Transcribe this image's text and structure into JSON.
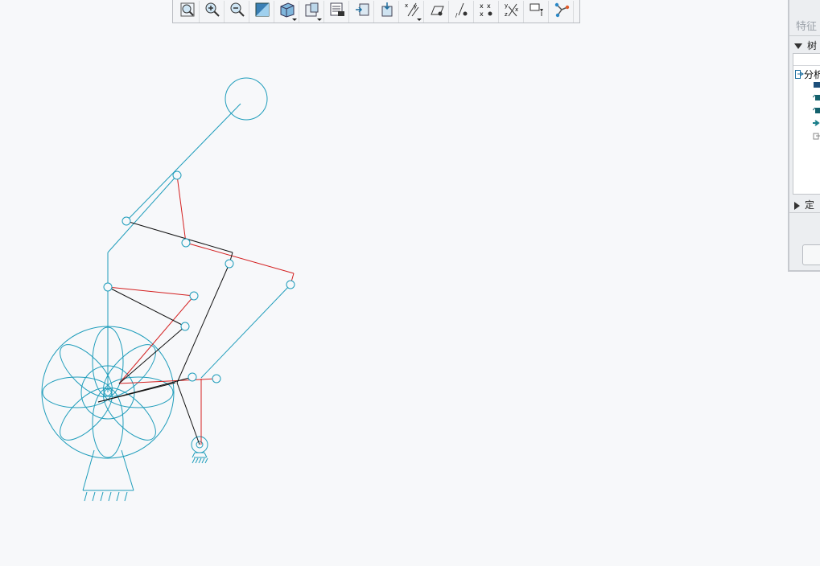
{
  "toolbar": {
    "buttons": [
      {
        "icon": "zoom-fit-icon",
        "has_dropdown": false
      },
      {
        "icon": "zoom-in-icon",
        "has_dropdown": false
      },
      {
        "icon": "zoom-out-icon",
        "has_dropdown": false
      },
      {
        "icon": "repaint-icon",
        "has_dropdown": false
      },
      {
        "icon": "display-style-icon",
        "has_dropdown": true
      },
      {
        "icon": "saved-orientations-icon",
        "has_dropdown": true
      },
      {
        "icon": "view-manager-icon",
        "has_dropdown": false
      },
      {
        "icon": "section-view-icon",
        "has_dropdown": false
      },
      {
        "icon": "perspective-icon",
        "has_dropdown": false
      },
      {
        "icon": "datum-display-icon",
        "has_dropdown": true
      },
      {
        "icon": "plane-display-icon",
        "has_dropdown": false
      },
      {
        "icon": "axis-display-icon",
        "has_dropdown": false
      },
      {
        "icon": "point-display-icon",
        "has_dropdown": false
      },
      {
        "icon": "csys-display-icon",
        "has_dropdown": false
      },
      {
        "icon": "annotation-display-icon",
        "has_dropdown": false
      },
      {
        "icon": "mechanism-icon",
        "has_dropdown": false
      }
    ]
  },
  "side_panel": {
    "title": "特征",
    "tree_section": {
      "label": "树",
      "expanded": true
    },
    "tree_root_label": "分析",
    "definition_section": {
      "label": "定",
      "expanded": false
    }
  },
  "colors": {
    "link_cyan": "#1f9dbb",
    "link_red": "#d42020",
    "link_black": "#111111",
    "background": "#f7f8fa"
  }
}
